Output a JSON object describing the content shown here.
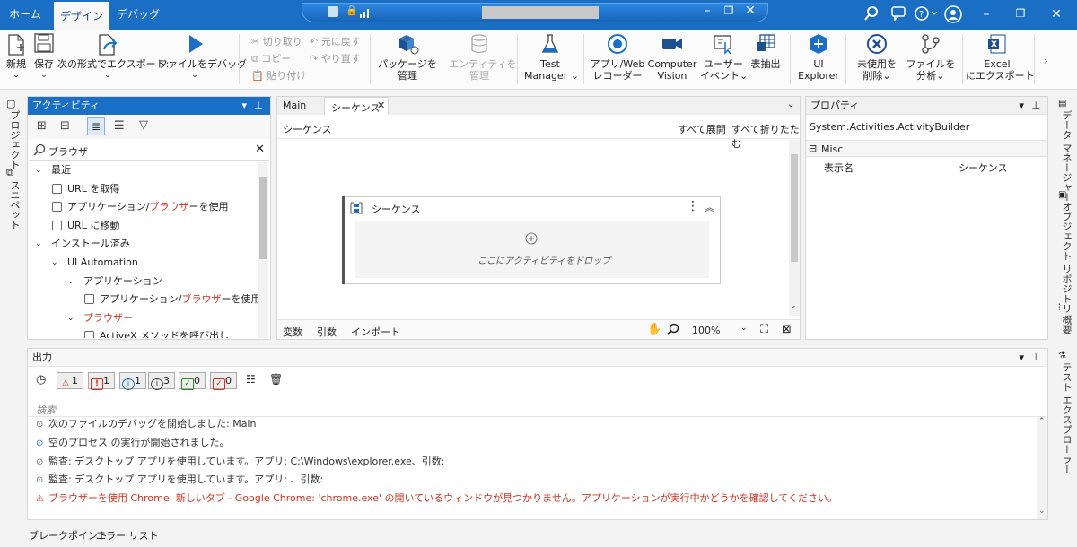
{
  "menu_tabs": [
    "ホーム",
    "デザイン",
    "デバッグ"
  ],
  "active_tab": "デザイン",
  "ribbon": {
    "new": "新規",
    "save": "保存",
    "export_as": "次の形式でエクスポート:",
    "debug_file": "ファイルをデバッグ",
    "cut": "切り取り",
    "copy": "コピー",
    "paste": "貼り付け",
    "undo": "元に戻す",
    "redo": "やり直す",
    "manage_packages": [
      "パッケージを",
      "管理"
    ],
    "manage_entities": [
      "エンティティを",
      "管理"
    ],
    "test_manager": [
      "Test",
      "Manager"
    ],
    "app_web_recorder": [
      "アプリ/Web",
      "レコーダー"
    ],
    "computer_vision": [
      "Computer",
      "Vision"
    ],
    "user_events": [
      "ユーザー",
      "イベント"
    ],
    "table_extract": "表抽出",
    "ui_explorer": [
      "UI",
      "Explorer"
    ],
    "remove_unused": [
      "未使用を",
      "削除"
    ],
    "analyze_file": [
      "ファイルを",
      "分析"
    ],
    "excel_export": [
      "Excel",
      "にエクスポート"
    ]
  },
  "left_side_tabs": [
    "プロジェクト",
    "スニペット"
  ],
  "right_side_tabs": [
    "データ マネージャー",
    "オブジェクト リポジトリ",
    "概要",
    "テスト エクスプローラー"
  ],
  "activities": {
    "title": "アクティビティ",
    "search_value": "ブラウザ",
    "tree": [
      {
        "label": "最近",
        "level": 0,
        "expand": "v"
      },
      {
        "label": "URL を取得",
        "level": 1
      },
      {
        "label_pre": "アプリケーション/",
        "label_hl": "ブラウザ",
        "label_post": "ーを使用",
        "level": 1,
        "selected": true
      },
      {
        "label": "URL に移動",
        "level": 1
      },
      {
        "label": "インストール済み",
        "level": 0,
        "expand": "v"
      },
      {
        "label": "UI Automation",
        "level": 1,
        "expand": "v"
      },
      {
        "label": "アプリケーション",
        "level": 2,
        "expand": "v"
      },
      {
        "label_pre": "アプリケーション/",
        "label_hl": "ブラウザ",
        "label_post": "ーを使用",
        "level": 3
      },
      {
        "label_hl": "ブラウザ",
        "label_post": "ー",
        "level": 2,
        "expand": "v"
      },
      {
        "label": "ActiveX メソッドを呼び出し",
        "level": 3
      }
    ]
  },
  "designer": {
    "tabs": [
      "Main",
      "シーケンス"
    ],
    "breadcrumb": "シーケンス",
    "expand_all": "すべて展開",
    "collapse_all": "すべて折りたたむ",
    "sequence_title": "シーケンス",
    "drop_hint": "ここにアクティビティをドロップ",
    "bottom_tabs": [
      "変数",
      "引数",
      "インポート"
    ],
    "zoom": "100%"
  },
  "properties": {
    "title": "プロパティ",
    "type_name": "System.Activities.ActivityBuilder",
    "category": "Misc",
    "rows": [
      {
        "name": "表示名",
        "value": "シーケンス"
      }
    ]
  },
  "output": {
    "title": "出力",
    "counts": {
      "warning": "1",
      "error": "1",
      "info": "1",
      "trace": "3",
      "verbose": "0",
      "debug": "0"
    },
    "search_placeholder": "検索",
    "lines": [
      {
        "text": "次のファイルのデバッグを開始しました: Main",
        "level": "trace"
      },
      {
        "text": "空のプロセス の実行が開始されました。",
        "level": "info"
      },
      {
        "text": "監査: デスクトップ アプリを使用しています。アプリ: C:\\Windows\\explorer.exe、引数:",
        "level": "trace"
      },
      {
        "text": "監査: デスクトップ アプリを使用しています。アプリ: 、引数:",
        "level": "trace"
      },
      {
        "text": "ブラウザーを使用 Chrome: 新しいタブ - Google Chrome: 'chrome.exe' の開いているウィンドウが見つかりません。アプリケーションが実行中かどうかを確認してください。",
        "level": "warning"
      }
    ]
  },
  "footer_tabs": [
    "ブレークポイント",
    "エラー リスト"
  ],
  "colors": {
    "accent": "#1a6fc4",
    "error": "#d0321f"
  }
}
